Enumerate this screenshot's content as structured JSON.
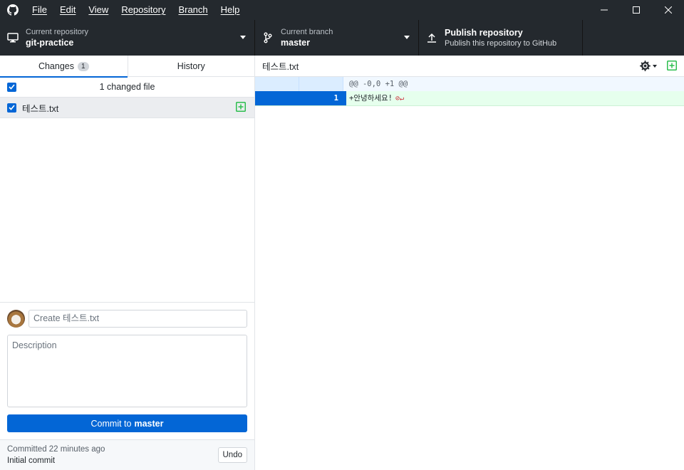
{
  "menu": [
    "File",
    "Edit",
    "View",
    "Repository",
    "Branch",
    "Help"
  ],
  "toolbar": {
    "repo_label": "Current repository",
    "repo_name": "git-practice",
    "branch_label": "Current branch",
    "branch_name": "master",
    "publish_title": "Publish repository",
    "publish_desc": "Publish this repository to GitHub"
  },
  "tabs": {
    "changes": "Changes",
    "changes_count": "1",
    "history": "History"
  },
  "changes": {
    "summary": "1 changed file",
    "files": [
      {
        "name": "테스트.txt",
        "status": "added"
      }
    ]
  },
  "commit": {
    "summary_placeholder": "Create 테스트.txt",
    "description_placeholder": "Description",
    "button_prefix": "Commit to",
    "button_branch": "master"
  },
  "last_commit": {
    "time": "Committed 22 minutes ago",
    "message": "Initial commit",
    "undo": "Undo"
  },
  "diff": {
    "filename": "테스트.txt",
    "hunk": "@@ -0,0 +1 @@",
    "lines": [
      {
        "old": "",
        "new": "1",
        "text": "+안녕하세요!"
      }
    ]
  },
  "colors": {
    "accent": "#0366d6",
    "added": "#2cbe4e",
    "titlebar": "#24292e"
  }
}
